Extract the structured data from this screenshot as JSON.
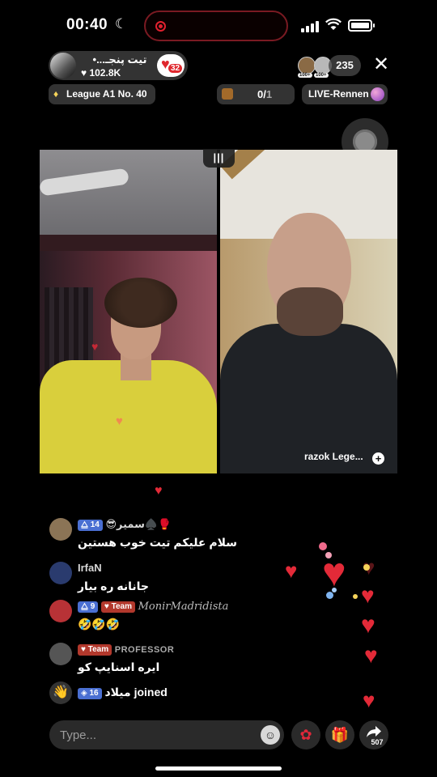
{
  "status_bar": {
    "time": "00:40"
  },
  "host": {
    "name": "تیت پنجـ...•",
    "likes": "♥ 102.8K",
    "badge_number": "32"
  },
  "viewers": {
    "count": "235",
    "avatar_labels": [
      "100+",
      "100+"
    ]
  },
  "league": {
    "label": "League A1 No. 40"
  },
  "task": {
    "progress": "0/",
    "total": "1",
    "value": 0,
    "goal": 1
  },
  "race": {
    "label": "LIVE-Rennen"
  },
  "guest": {
    "name": "razok Lege..."
  },
  "comments": [
    {
      "level": "14",
      "username": "😎سمیر♠️🥊",
      "text": "سلام علیکم تیت خوب هستین",
      "avatar_color": "#8b7456"
    },
    {
      "username": "IrfaN",
      "text": "جانانه ره بیار",
      "avatar_color": "#2a3b6e"
    },
    {
      "level": "9",
      "team": "Team",
      "username": "MonirMadridista",
      "text": "🤣🤣🤣",
      "avatar_color": "#b83236"
    },
    {
      "team": "Team",
      "username": "PROFESSOR",
      "text": "ایره اسنایپ کو",
      "avatar_color": "#555555"
    }
  ],
  "join_event": {
    "level": "16",
    "username": "میلاد",
    "action": "joined"
  },
  "input": {
    "placeholder": "Type..."
  },
  "share": {
    "count": "507"
  },
  "colors": {
    "accent_red": "#e32a38",
    "level_blue": "#4a6fd2",
    "team_red": "#b2382c"
  }
}
